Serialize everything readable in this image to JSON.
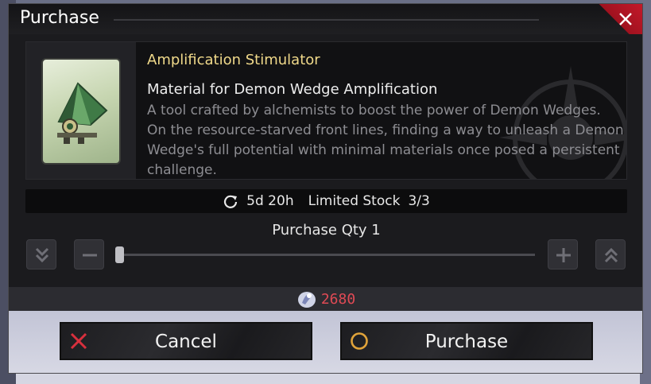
{
  "dialog": {
    "title": "Purchase",
    "item": {
      "name": "Amplification Stimulator",
      "subtitle": "Material for Demon Wedge Amplification",
      "description": "A tool crafted by alchemists to boost the power of Demon Wedges. On the resource-starved front lines, finding a way to unleash a Demon Wedge's full potential with minimal materials once posed a persistent challenge."
    },
    "stock": {
      "refresh_time": "5d 20h",
      "label": "Limited Stock",
      "count": "3/3"
    },
    "quantity": {
      "label": "Purchase Qty 1"
    },
    "cost": {
      "value": "2680"
    },
    "buttons": {
      "cancel": "Cancel",
      "purchase": "Purchase"
    }
  },
  "colors": {
    "accent_red": "#c4192a",
    "item_name_gold": "#f0d98a",
    "cost_red": "#e04a55",
    "confirm_ring": "#e0a33a"
  },
  "icons": {
    "close": "close-icon",
    "refresh": "refresh-icon",
    "min": "double-chevron-down-icon",
    "decrease": "minus-icon",
    "increase": "plus-icon",
    "max": "double-chevron-up-icon",
    "currency": "crystal-currency-icon",
    "cancel": "x-icon",
    "confirm": "circle-icon"
  }
}
